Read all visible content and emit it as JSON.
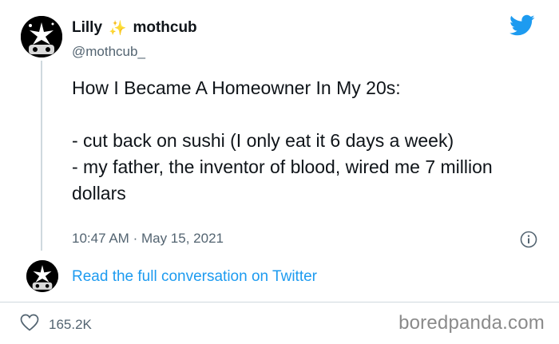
{
  "header": {
    "display_name": "Lilly",
    "sparkle_glyph": "✨",
    "display_name_suffix": "mothcub",
    "handle": "@mothcub_",
    "platform_icon": "twitter-bird-icon",
    "accent_color": "#1d9bf0"
  },
  "tweet": {
    "text": "How I Became A Homeowner In My 20s:\n\n- cut back on sushi (I only eat it 6 days a week)\n- my father, the inventor of blood, wired me 7 million dollars",
    "time": "10:47 AM",
    "separator": "·",
    "date": "May 15, 2021"
  },
  "reply_prompt": {
    "link_text": "Read the full conversation on Twitter"
  },
  "actions": {
    "like_icon": "heart-icon",
    "like_count": "165.2K"
  },
  "watermark": {
    "text": "boredpanda.com"
  }
}
